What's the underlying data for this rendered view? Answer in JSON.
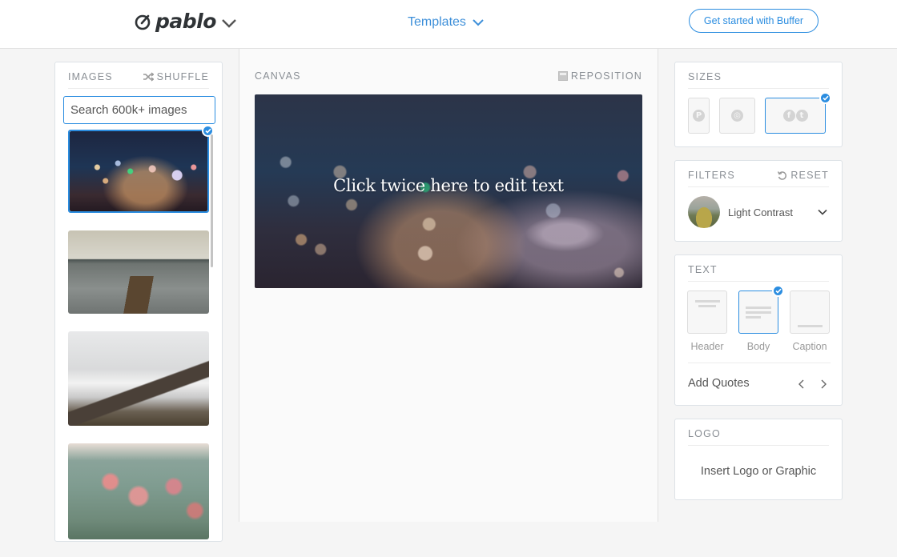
{
  "header": {
    "logo_text": "pablo",
    "templates_label": "Templates",
    "cta_label": "Get started with Buffer"
  },
  "images_panel": {
    "title": "IMAGES",
    "shuffle_label": "SHUFFLE",
    "search_placeholder": "Search 600k+ images",
    "search_value": "",
    "thumbnails": [
      {
        "subject": "city bokeh lights at night",
        "selected": true
      },
      {
        "subject": "wooden pier on a lake",
        "selected": false
      },
      {
        "subject": "snowy mountain with birds",
        "selected": false
      },
      {
        "subject": "pink wildflowers in a field",
        "selected": false
      }
    ]
  },
  "canvas": {
    "title": "CANVAS",
    "reposition_label": "REPOSITION",
    "overlay_text": "Click twice here to edit text"
  },
  "sizes": {
    "title": "SIZES",
    "options": [
      {
        "name": "Pinterest",
        "icons": [
          "P"
        ],
        "selected": false
      },
      {
        "name": "Instagram",
        "icons": [
          "◎"
        ],
        "selected": false
      },
      {
        "name": "Facebook / Twitter",
        "icons": [
          "f",
          "t"
        ],
        "selected": true
      }
    ]
  },
  "filters": {
    "title": "FILTERS",
    "reset_label": "RESET",
    "selected_filter": "Light Contrast"
  },
  "text": {
    "title": "TEXT",
    "options": [
      {
        "label": "Header",
        "selected": false
      },
      {
        "label": "Body",
        "selected": true
      },
      {
        "label": "Caption",
        "selected": false
      }
    ],
    "add_quotes_label": "Add Quotes"
  },
  "logo": {
    "title": "LOGO",
    "insert_label": "Insert Logo or Graphic"
  },
  "colors": {
    "accent": "#2b8de0",
    "templates_link": "#3d8fd9",
    "page_bg": "#f5f5f5"
  }
}
